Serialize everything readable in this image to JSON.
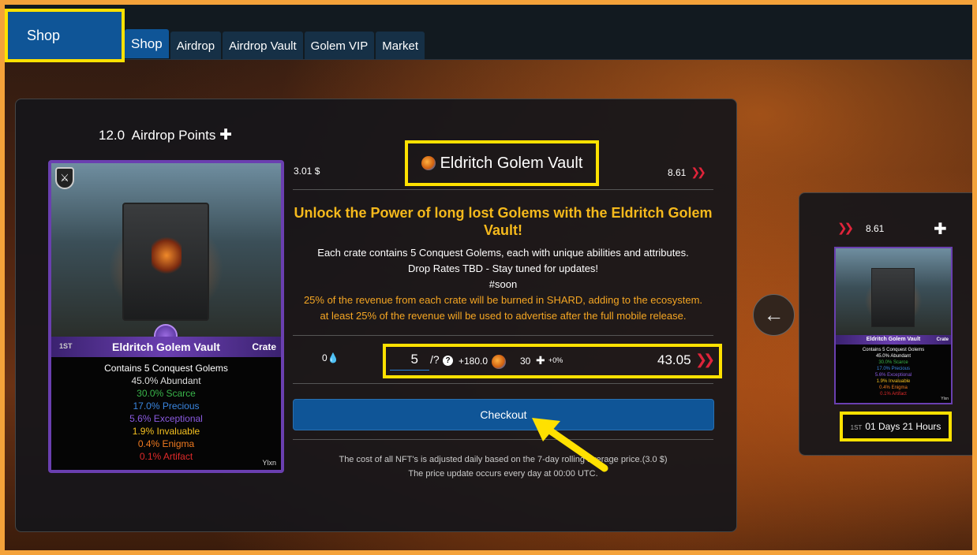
{
  "nav": {
    "shop_title": "Shop",
    "tabs": [
      {
        "label": "Shop",
        "active": true
      },
      {
        "label": "Airdrop",
        "active": false
      },
      {
        "label": "Airdrop Vault",
        "active": false
      },
      {
        "label": "Golem VIP",
        "active": false
      },
      {
        "label": "Market",
        "active": false
      }
    ]
  },
  "airdrop_points": {
    "value": "12.0",
    "label": "Airdrop Points",
    "icon": "plus-cross-icon"
  },
  "card": {
    "edition": "1ST",
    "name": "Eldritch Golem Vault",
    "type": "Crate",
    "contains": "Contains 5 Conquest Golems",
    "rates": {
      "abundant": "45.0% Abundant",
      "scarce": "30.0% Scarce",
      "precious": "17.0% Precious",
      "exceptional": "5.6% Exceptional",
      "invaluable": "1.9% Invaluable",
      "enigma": "0.4% Enigma",
      "artifact": "0.1% Artifact"
    },
    "author": "Ylxn"
  },
  "product": {
    "price_usd": "3.01 $",
    "title": "Eldritch Golem Vault",
    "price_hive": "8.61",
    "headline": "Unlock the Power of long lost Golems with the Eldritch Golem Vault!",
    "desc1": "Each crate contains 5 Conquest Golems, each with unique abilities and attributes.",
    "desc2": "Drop Rates TBD - Stay tuned for updates!",
    "desc3": "#soon",
    "desc4": "25% of the revenue from each crate will be burned in SHARD, adding to the ecosystem.",
    "desc5": "at least 25% of the revenue will be used to advertise after the full mobile release."
  },
  "purchase": {
    "drops": "0",
    "quantity": "5",
    "max": "/?",
    "bonus": "+180.0",
    "points": "30",
    "points_pct": "+0%",
    "total": "43.05",
    "checkout_label": "Checkout"
  },
  "footnote": {
    "line1": "The cost of all NFT's is adjusted daily based on the 7-day rolling average price.(3.0 $)",
    "line2": "The price update occurs every day at 00:00 UTC."
  },
  "side": {
    "price_hive": "8.61",
    "mini_card": {
      "edition": "1ST",
      "name": "Eldritch Golem Vault",
      "type": "Crate",
      "contains": "Contains 5 Conquest Golems",
      "abundant": "45.0% Abundant",
      "scarce": "30.0% Scarce",
      "precious": "17.0% Precious",
      "exceptional": "5.6% Exceptional",
      "invaluable": "1.9% Invaluable",
      "enigma": "0.4% Enigma",
      "artifact": "0.1% Artifact",
      "author": "Ylxn"
    },
    "timer_edition": "1ST",
    "timer": "01 Days 21 Hours"
  },
  "colors": {
    "accent": "#0f5597",
    "highlight": "#ffe100",
    "hive_red": "#e0243a",
    "headline": "#f5b91c"
  }
}
